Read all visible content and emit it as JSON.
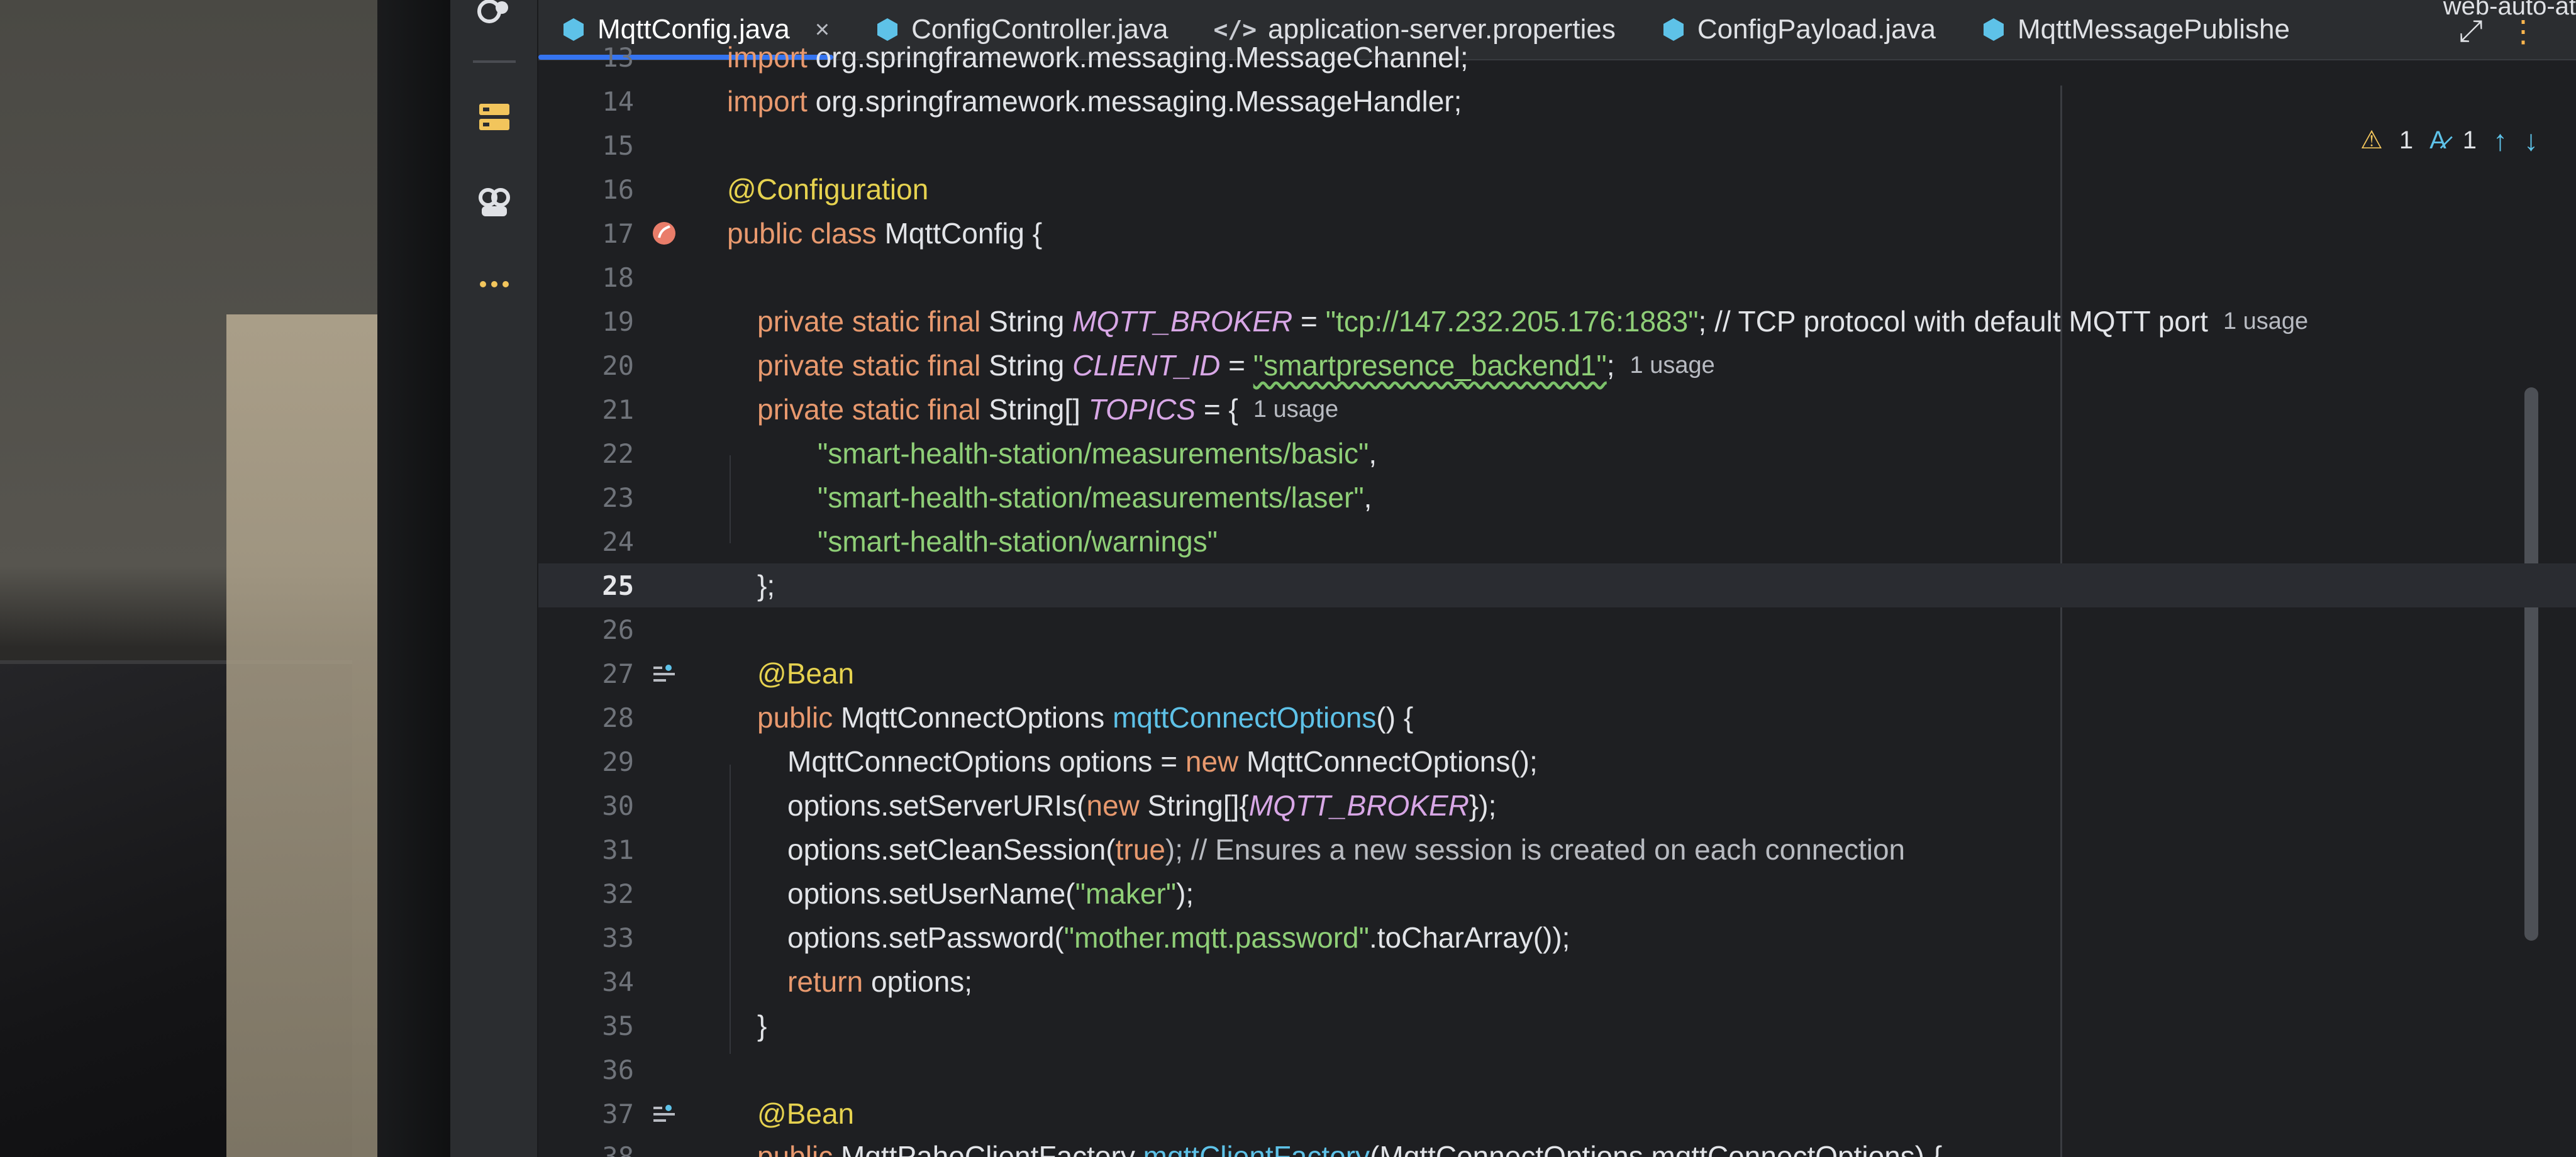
{
  "window_title": "web-auto-at",
  "tabs": [
    {
      "label": "MqttConfig.java",
      "type": "java",
      "active": true,
      "close": "×"
    },
    {
      "label": "ConfigController.java",
      "type": "java",
      "active": false
    },
    {
      "label": "application-server.properties",
      "type": "props",
      "icon_text": "</>",
      "active": false
    },
    {
      "label": "ConfigPayload.java",
      "type": "java",
      "active": false
    },
    {
      "label": "MqttMessagePublishe",
      "type": "java",
      "active": false
    }
  ],
  "inspections": {
    "warnings": "1",
    "typos": "1"
  },
  "current_line": "25",
  "lines": {
    "l13": {
      "num": "13",
      "a": "import ",
      "b": "org.springframework.messaging.MessageChannel;"
    },
    "l14": {
      "num": "14",
      "a": "import ",
      "b": "org.springframework.messaging.MessageHandler;"
    },
    "l15": {
      "num": "15"
    },
    "l16": {
      "num": "16",
      "a": "@Configuration"
    },
    "l17": {
      "num": "17",
      "a": "public class ",
      "b": "MqttConfig {"
    },
    "l18": {
      "num": "18"
    },
    "l19": {
      "num": "19",
      "a": "private static final ",
      "b": "String ",
      "c": "MQTT_BROKER",
      "d": " = ",
      "e": "\"tcp://147.232.205.176:1883\"",
      "f": "; // TCP protocol with default MQTT port",
      "hint": "1 usage"
    },
    "l20": {
      "num": "20",
      "a": "private static final ",
      "b": "String ",
      "c": "CLIENT_ID",
      "d": " = ",
      "e": "\"smartpresence_backend1\"",
      "f": ";",
      "hint": "1 usage"
    },
    "l21": {
      "num": "21",
      "a": "private static final ",
      "b": "String[] ",
      "c": "TOPICS",
      "d": " = {",
      "hint": "1 usage"
    },
    "l22": {
      "num": "22",
      "a": "\"smart-health-station/measurements/basic\"",
      "b": ","
    },
    "l23": {
      "num": "23",
      "a": "\"smart-health-station/measurements/laser\"",
      "b": ","
    },
    "l24": {
      "num": "24",
      "a": "\"smart-health-station/warnings\""
    },
    "l25": {
      "num": "25",
      "a": "};"
    },
    "l26": {
      "num": "26"
    },
    "l27": {
      "num": "27",
      "a": "@Bean"
    },
    "l28": {
      "num": "28",
      "a": "public ",
      "b": "MqttConnectOptions ",
      "c": "mqttConnectOptions",
      "d": "() {"
    },
    "l29": {
      "num": "29",
      "a": "MqttConnectOptions options = ",
      "b": "new ",
      "c": "MqttConnectOptions();"
    },
    "l30": {
      "num": "30",
      "a": "options.setServerURIs(",
      "b": "new ",
      "c": "String[]{",
      "d": "MQTT_BROKER",
      "e": "});"
    },
    "l31": {
      "num": "31",
      "a": "options.setCleanSession(",
      "b": "true",
      "c": "); // Ensures a new session is created on each connection"
    },
    "l32": {
      "num": "32",
      "a": "options.setUserName(",
      "b": "\"maker\"",
      "c": ");"
    },
    "l33": {
      "num": "33",
      "a": "options.setPassword(",
      "b": "\"mother.mqtt.password\"",
      "c": ".toCharArray());"
    },
    "l34": {
      "num": "34",
      "a": "return ",
      "b": "options;"
    },
    "l35": {
      "num": "35",
      "a": "}"
    },
    "l36": {
      "num": "36"
    },
    "l37": {
      "num": "37",
      "a": "@Bean"
    },
    "l38": {
      "num": "38",
      "a": "public ",
      "b": "MqttPahoClientFactory ",
      "c": "mqttClientFactory",
      "d": "(MqttConnectOptions mqttConnectOptions) {"
    }
  },
  "colors": {
    "keyword": "#e8996e",
    "annotation": "#e6d24f",
    "string": "#8fcf77",
    "constant": "#d8a7e6",
    "method": "#5ec2e8",
    "accent": "#3574f0"
  }
}
